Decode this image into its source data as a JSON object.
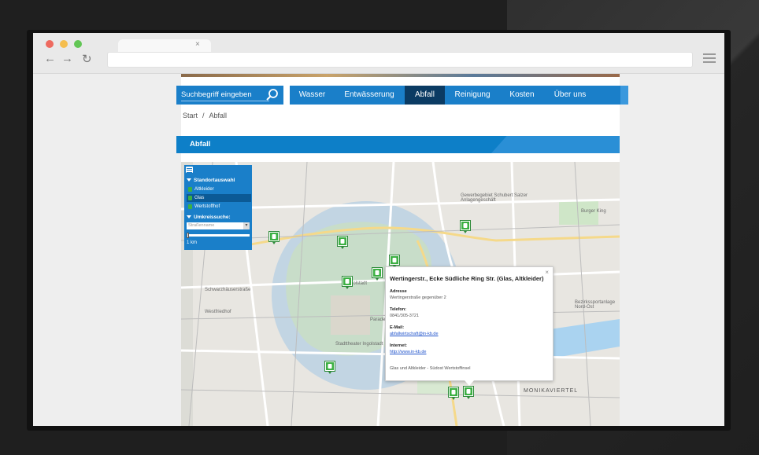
{
  "browser": {
    "tab_close": "×",
    "nav_back": "←",
    "nav_forward": "→",
    "nav_reload": "↻"
  },
  "search": {
    "placeholder": "Suchbegriff eingeben"
  },
  "nav": {
    "items": [
      {
        "label": "Wasser"
      },
      {
        "label": "Entwässerung"
      },
      {
        "label": "Abfall"
      },
      {
        "label": "Reinigung"
      },
      {
        "label": "Kosten"
      },
      {
        "label": "Über uns"
      }
    ],
    "active": "Abfall"
  },
  "breadcrumb": {
    "home": "Start",
    "separator": "/",
    "current": "Abfall"
  },
  "section": {
    "title": "Abfall"
  },
  "map_control": {
    "location_heading": "Standortauswahl",
    "items": [
      {
        "label": "Altkleider"
      },
      {
        "label": "Glas"
      },
      {
        "label": "Wertstoffhof"
      }
    ],
    "radius_heading": "Umkreissuche:",
    "street_placeholder": "Straßenname",
    "dropdown_arrow": "▾",
    "radius_value": "1 km"
  },
  "popup": {
    "close": "×",
    "title": "Wertingerstr., Ecke Südliche Ring Str. (Glas, Altkleider)",
    "address_label": "Adresse",
    "address": "Wertingerstraße gegenüber 2",
    "phone_label": "Telefon:",
    "phone": "0841/305-3721",
    "email_label": "E-Mail:",
    "email": "abfallwirtschaft@in-kb.de",
    "internet_label": "Internet:",
    "internet": "http://www.in-kb.de",
    "note": "Glas und Altkleider - Südost Wertstoffinsel"
  },
  "map_labels": {
    "ingolstadt": "Ingolstadt",
    "monikaviertel": "MONIKAVIERTEL",
    "gewerbegebiet": "Gewerbegebiet Schubert Salzer Anlagengeschäft",
    "bezirksportanlage": "Bezirkssportanlage Nord-Ost",
    "stadttheater": "Stadttheater Ingolstadt",
    "westfriedhof": "Westfriedhof",
    "schwarzhaeuserstr": "Schwarzhäuserstraße",
    "parade": "Paradeplatz",
    "burger_king": "Burger King"
  },
  "colors": {
    "primary": "#1a7fc9",
    "active_nav": "#0b3b63",
    "pin_green": "#3cb043",
    "radius_fill": "#9cc4e6"
  }
}
